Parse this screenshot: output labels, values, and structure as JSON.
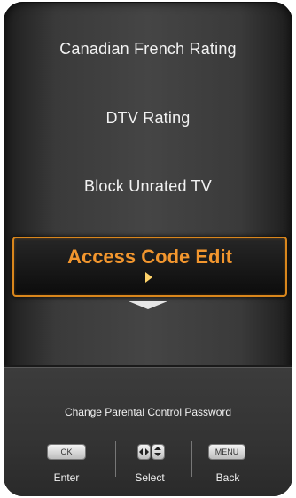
{
  "menu": {
    "items": [
      {
        "label": "Canadian French Rating"
      },
      {
        "label": "DTV Rating"
      },
      {
        "label": "Block Unrated TV"
      }
    ],
    "selected": {
      "label": "Access Code Edit"
    }
  },
  "footer": {
    "hint": "Change Parental  Control Password",
    "buttons": {
      "ok_key": "OK",
      "menu_key": "MENU",
      "enter": "Enter",
      "select": "Select",
      "back": "Back"
    }
  },
  "colors": {
    "accent": "#d9861c",
    "selected_text": "#f2962e"
  }
}
